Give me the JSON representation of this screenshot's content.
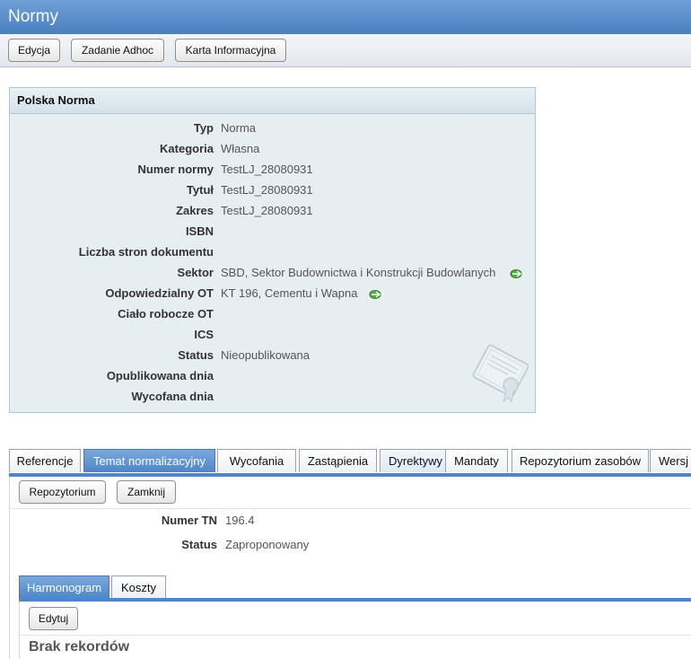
{
  "window": {
    "title": "Normy"
  },
  "toolbar": {
    "buttons": [
      "Edycja",
      "Zadanie Adhoc",
      "Karta Informacyjna"
    ]
  },
  "details": {
    "title": "Polska Norma",
    "fields": [
      {
        "label": "Typ",
        "value": "Norma"
      },
      {
        "label": "Kategoria",
        "value": "Własna"
      },
      {
        "label": "Numer normy",
        "value": "TestLJ_28080931"
      },
      {
        "label": "Tytuł",
        "value": "TestLJ_28080931"
      },
      {
        "label": "Zakres",
        "value": "TestLJ_28080931"
      },
      {
        "label": "ISBN",
        "value": ""
      },
      {
        "label": "Liczba stron dokumentu",
        "value": ""
      },
      {
        "label": "Sektor",
        "value": "SBD, Sektor Budownictwa i Konstrukcji Budowlanych"
      },
      {
        "label": "Odpowiedzialny OT",
        "value": "KT 196, Cementu i Wapna"
      },
      {
        "label": "Ciało robocze OT",
        "value": ""
      },
      {
        "label": "ICS",
        "value": ""
      },
      {
        "label": "Status",
        "value": "Nieopublikowana"
      },
      {
        "label": "Opublikowana dnia",
        "value": ""
      },
      {
        "label": "Wycofana dnia",
        "value": ""
      }
    ]
  },
  "tabs": [
    "Referencje",
    "Temat normalizacyjny",
    "Wycofania",
    "Zastąpienia",
    "Dyrektywy",
    "Mandaty",
    "Repozytorium zasobów",
    "Wersj"
  ],
  "topic": {
    "buttons": [
      "Repozytorium",
      "Zamknij"
    ],
    "fields": [
      {
        "label": "Numer TN",
        "value": "196.4"
      },
      {
        "label": "Status",
        "value": "Zaproponowany"
      }
    ]
  },
  "subtabs": [
    "Harmonogram",
    "Koszty"
  ],
  "schedule": {
    "edit_button": "Edytuj",
    "empty_text": "Brak rekordów"
  },
  "colors": {
    "accent": "#4f86c9",
    "panel_bg": "#e6eef2",
    "link_icon": "#4caf3a"
  },
  "icons": {
    "link": "link-arrow-icon",
    "watermark": "certificate-icon"
  }
}
